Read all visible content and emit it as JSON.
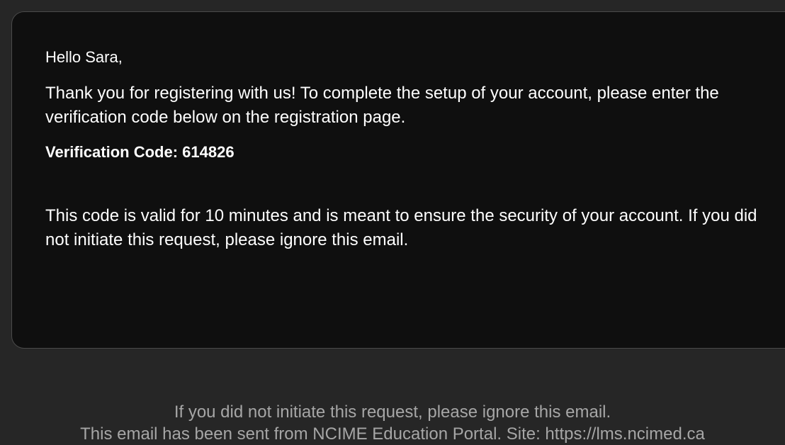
{
  "email": {
    "greeting": "Hello Sara,",
    "paragraph1": "Thank you for registering with us! To complete the setup of your account, please enter the verification code below on the registration page.",
    "code_label": "Verification Code:",
    "code_value": "614826",
    "paragraph2": "This code is valid for 10 minutes and is meant to ensure the security of your account. If you did not initiate this request, please ignore this email."
  },
  "footer": {
    "line1": "If you did not initiate this request, please ignore this email.",
    "line2": "This email has been sent from NCIME Education Portal. Site: https://lms.ncimed.ca"
  },
  "colors": {
    "page_background": "#262626",
    "card_background": "#0f0f0f",
    "card_border": "#4a4a4a",
    "body_text": "#ffffff",
    "footer_text": "#a6a6a6"
  }
}
